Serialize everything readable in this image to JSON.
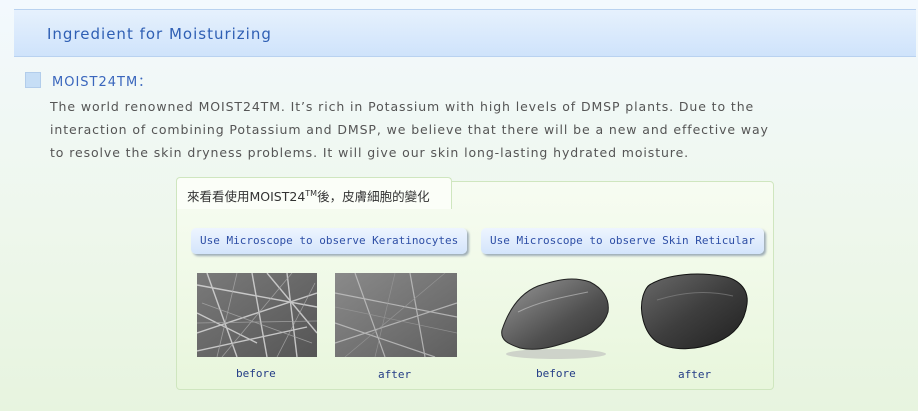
{
  "header": {
    "title": "Ingredient for Moisturizing"
  },
  "section": {
    "label": "MOIST24TM：",
    "lines": [
      "The world renowned MOIST24TM.  It’s rich in Potassium with high levels of DMSP plants.  Due to the",
      "interaction of combining Potassium and DMSP, we believe that there will be a new and effective way",
      "to resolve the skin dryness problems.  It will give our skin long-lasting hydrated moisture."
    ]
  },
  "panel": {
    "tab_title_a": "來看看使用MOIST24",
    "tab_title_tm": "TM",
    "tab_title_b": "後，皮膚細胞的變化",
    "left_pill": "Use Microscope to observe Keratinocytes",
    "right_pill": "Use Microscope to observe Skin Reticular",
    "captions": [
      "before",
      "after",
      "before",
      "after"
    ]
  }
}
